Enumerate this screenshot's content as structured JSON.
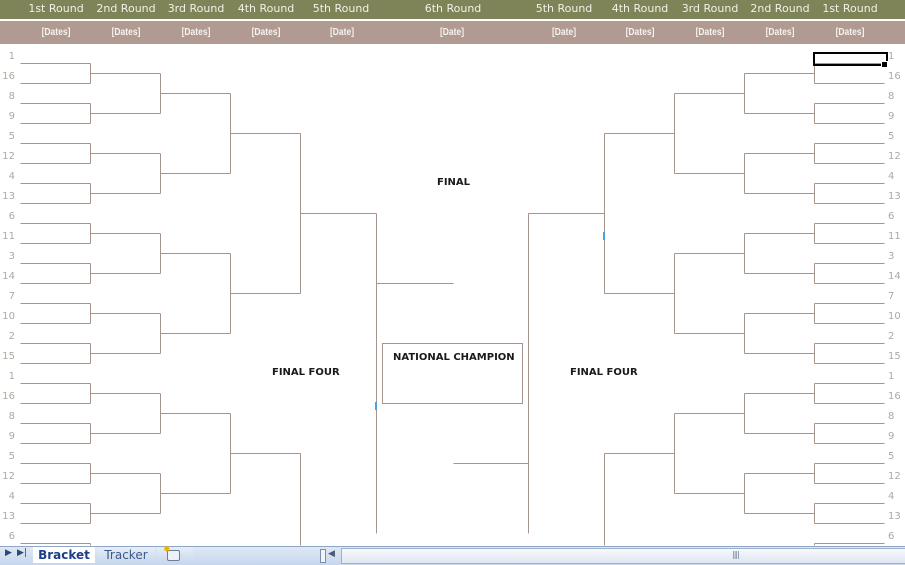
{
  "header": {
    "rounds_left": [
      "1st Round",
      "2nd Round",
      "3rd Round",
      "4th Round",
      "5th Round"
    ],
    "round_center": "6th Round",
    "rounds_right": [
      "5th Round",
      "4th Round",
      "3rd Round",
      "2nd Round",
      "1st Round"
    ],
    "dates_left": [
      "[Dates]",
      "[Dates]",
      "[Dates]",
      "[Dates]",
      "[Date]"
    ],
    "date_center": "[Date]",
    "dates_right": [
      "[Date]",
      "[Dates]",
      "[Dates]",
      "[Dates]",
      "[Dates]"
    ]
  },
  "colors": {
    "header_top": "#7e8358",
    "header_bottom": "#b09a92",
    "bracket_line": "#a6958d",
    "seed_text": "#b0a8a2"
  },
  "seeds_left": [
    "1",
    "16",
    "8",
    "9",
    "5",
    "12",
    "4",
    "13",
    "6",
    "11",
    "3",
    "14",
    "7",
    "10",
    "2",
    "15",
    "1",
    "16",
    "8",
    "9",
    "5",
    "12",
    "4",
    "13",
    "6"
  ],
  "seeds_right": [
    "1",
    "16",
    "8",
    "9",
    "5",
    "12",
    "4",
    "13",
    "6",
    "11",
    "3",
    "14",
    "7",
    "10",
    "2",
    "15",
    "1",
    "16",
    "8",
    "9",
    "5",
    "12",
    "4",
    "13",
    "6"
  ],
  "center": {
    "final_label": "FINAL",
    "final_four_left": "FINAL FOUR",
    "final_four_right": "FINAL FOUR",
    "national_champion": "NATIONAL CHAMPION"
  },
  "sheet_tabs": {
    "tabs": [
      "Bracket",
      "Tracker"
    ],
    "active": "Bracket",
    "nav_next": "▶",
    "nav_last": "▶|",
    "insert_sheet_icon": "insert-worksheet-icon"
  }
}
